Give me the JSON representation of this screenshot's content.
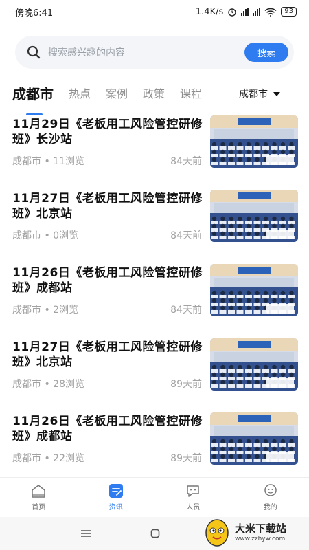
{
  "status_bar": {
    "time": "傍晚6:41",
    "speed": "1.4K/s",
    "battery": "93"
  },
  "search": {
    "placeholder": "搜索感兴趣的内容",
    "button_label": "搜索"
  },
  "tabs": [
    {
      "label": "成都市",
      "active": true
    },
    {
      "label": "热点",
      "active": false
    },
    {
      "label": "案例",
      "active": false
    },
    {
      "label": "政策",
      "active": false
    },
    {
      "label": "课程",
      "active": false
    }
  ],
  "city_selector": {
    "label": "成都市"
  },
  "news": [
    {
      "title": "11月29日《老板用工风险管控研修班》长沙站",
      "city": "成都市",
      "views": "11浏览",
      "age": "84天前"
    },
    {
      "title": "11月27日《老板用工风险管控研修班》北京站",
      "city": "成都市",
      "views": "0浏览",
      "age": "84天前"
    },
    {
      "title": "11月26日《老板用工风险管控研修班》成都站",
      "city": "成都市",
      "views": "2浏览",
      "age": "84天前"
    },
    {
      "title": "11月27日《老板用工风险管控研修班》北京站",
      "city": "成都市",
      "views": "28浏览",
      "age": "89天前"
    },
    {
      "title": "11月26日《老板用工风险管控研修班》成都站",
      "city": "成都市",
      "views": "22浏览",
      "age": "89天前"
    }
  ],
  "meta_separator": " • ",
  "bottom_nav": [
    {
      "label": "首页",
      "icon": "home-icon",
      "active": false
    },
    {
      "label": "资讯",
      "icon": "news-icon",
      "active": true
    },
    {
      "label": "人员",
      "icon": "people-icon",
      "active": false
    },
    {
      "label": "我的",
      "icon": "profile-icon",
      "active": false
    }
  ],
  "watermark": {
    "title": "大米下载站",
    "url": "www.zzhyw.com"
  },
  "colors": {
    "accent": "#2f7cf0",
    "meta_text": "#a2a2a2"
  }
}
